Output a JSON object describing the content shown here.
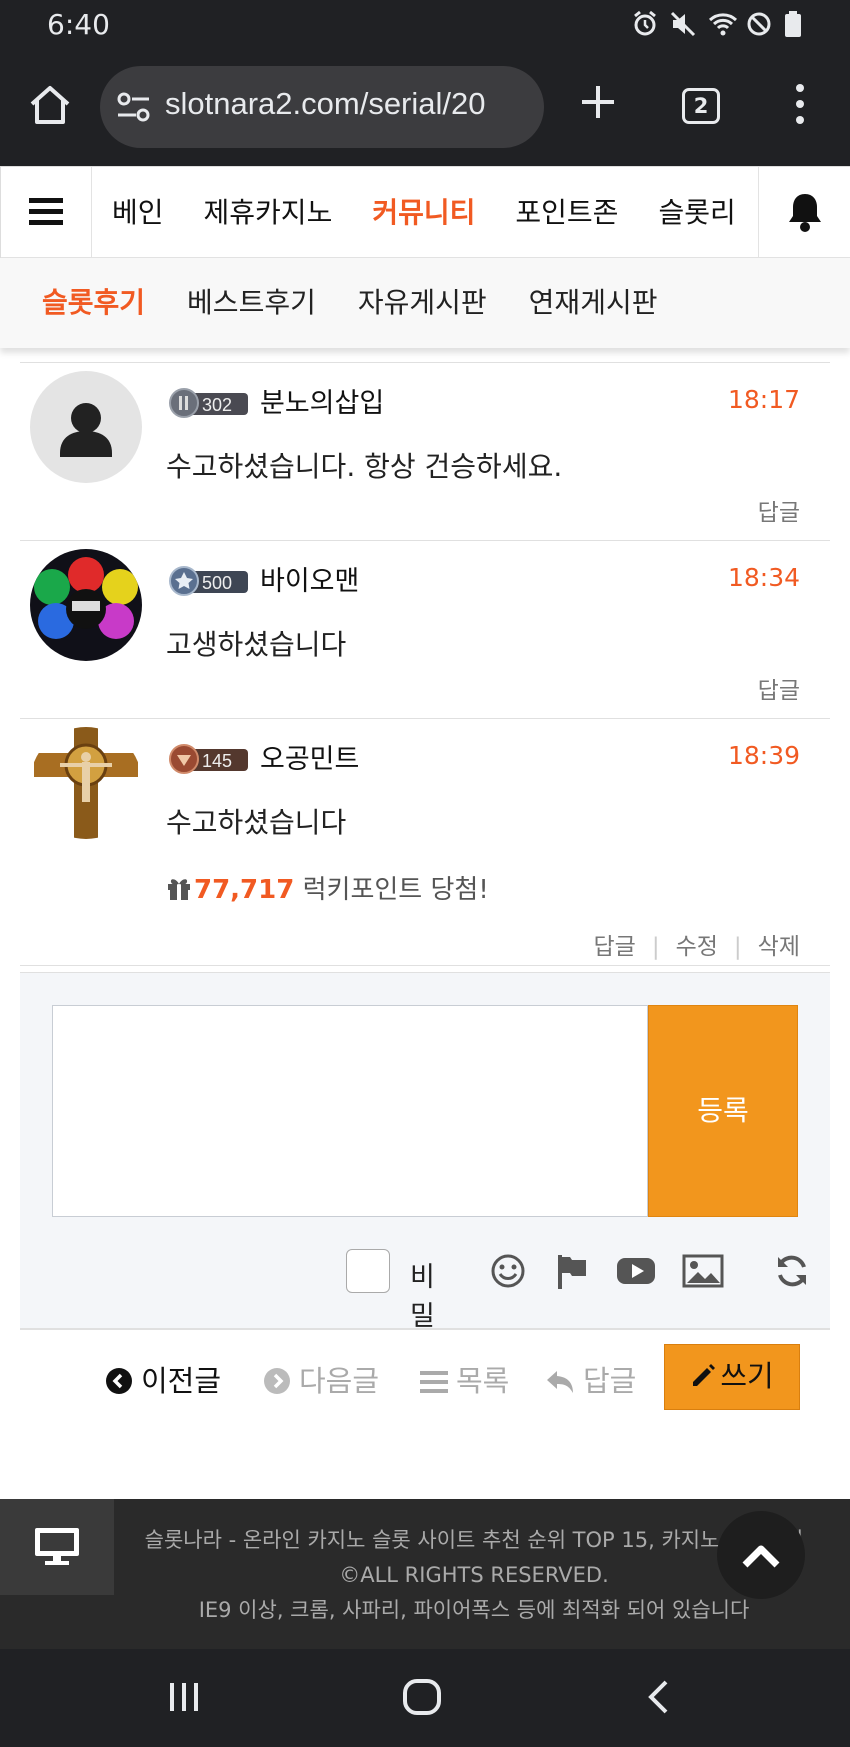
{
  "status": {
    "time": "6:40"
  },
  "browser": {
    "url": "slotnara2.com/serial/20",
    "tab_count": "2"
  },
  "nav": {
    "items": [
      "베인",
      "제휴카지노",
      "커뮤니티",
      "포인트존",
      "슬롯리"
    ],
    "active": "커뮤니티"
  },
  "subnav": {
    "items": [
      "슬롯후기",
      "베스트후기",
      "자유게시판",
      "연재게시판"
    ],
    "active": "슬롯후기"
  },
  "comments": [
    {
      "level": "302",
      "user": "분노의삽입",
      "time": "18:17",
      "text": "수고하셨습니다. 항상 건승하세요.",
      "reply": "답글"
    },
    {
      "level": "500",
      "user": "바이오맨",
      "time": "18:34",
      "text": "고생하셨습니다",
      "reply": "답글"
    },
    {
      "level": "145",
      "user": "오공민트",
      "time": "18:39",
      "text": "수고하셨습니다",
      "lucky_points": "77,717",
      "lucky_text": "럭키포인트 당첨!",
      "reply": "답글",
      "edit": "수정",
      "delete": "삭제"
    }
  ],
  "form": {
    "submit": "등록",
    "secret": "비밀"
  },
  "board_nav": {
    "prev": "이전글",
    "next": "다음글",
    "list": "목록",
    "reply": "답글",
    "write": "쓰기"
  },
  "footer": {
    "line1": "슬롯나라 - 온라인 카지노 슬롯 사이트 추천 순위 TOP 15, 카지노 커뮤니티",
    "line2": "©ALL RIGHTS RESERVED.",
    "line3": "IE9 이상, 크롬, 사파리, 파이어폭스 등에 최적화 되어 있습니다"
  },
  "colors": {
    "accent": "#f15a22",
    "button": "#f2961d",
    "dark": "#202124"
  }
}
